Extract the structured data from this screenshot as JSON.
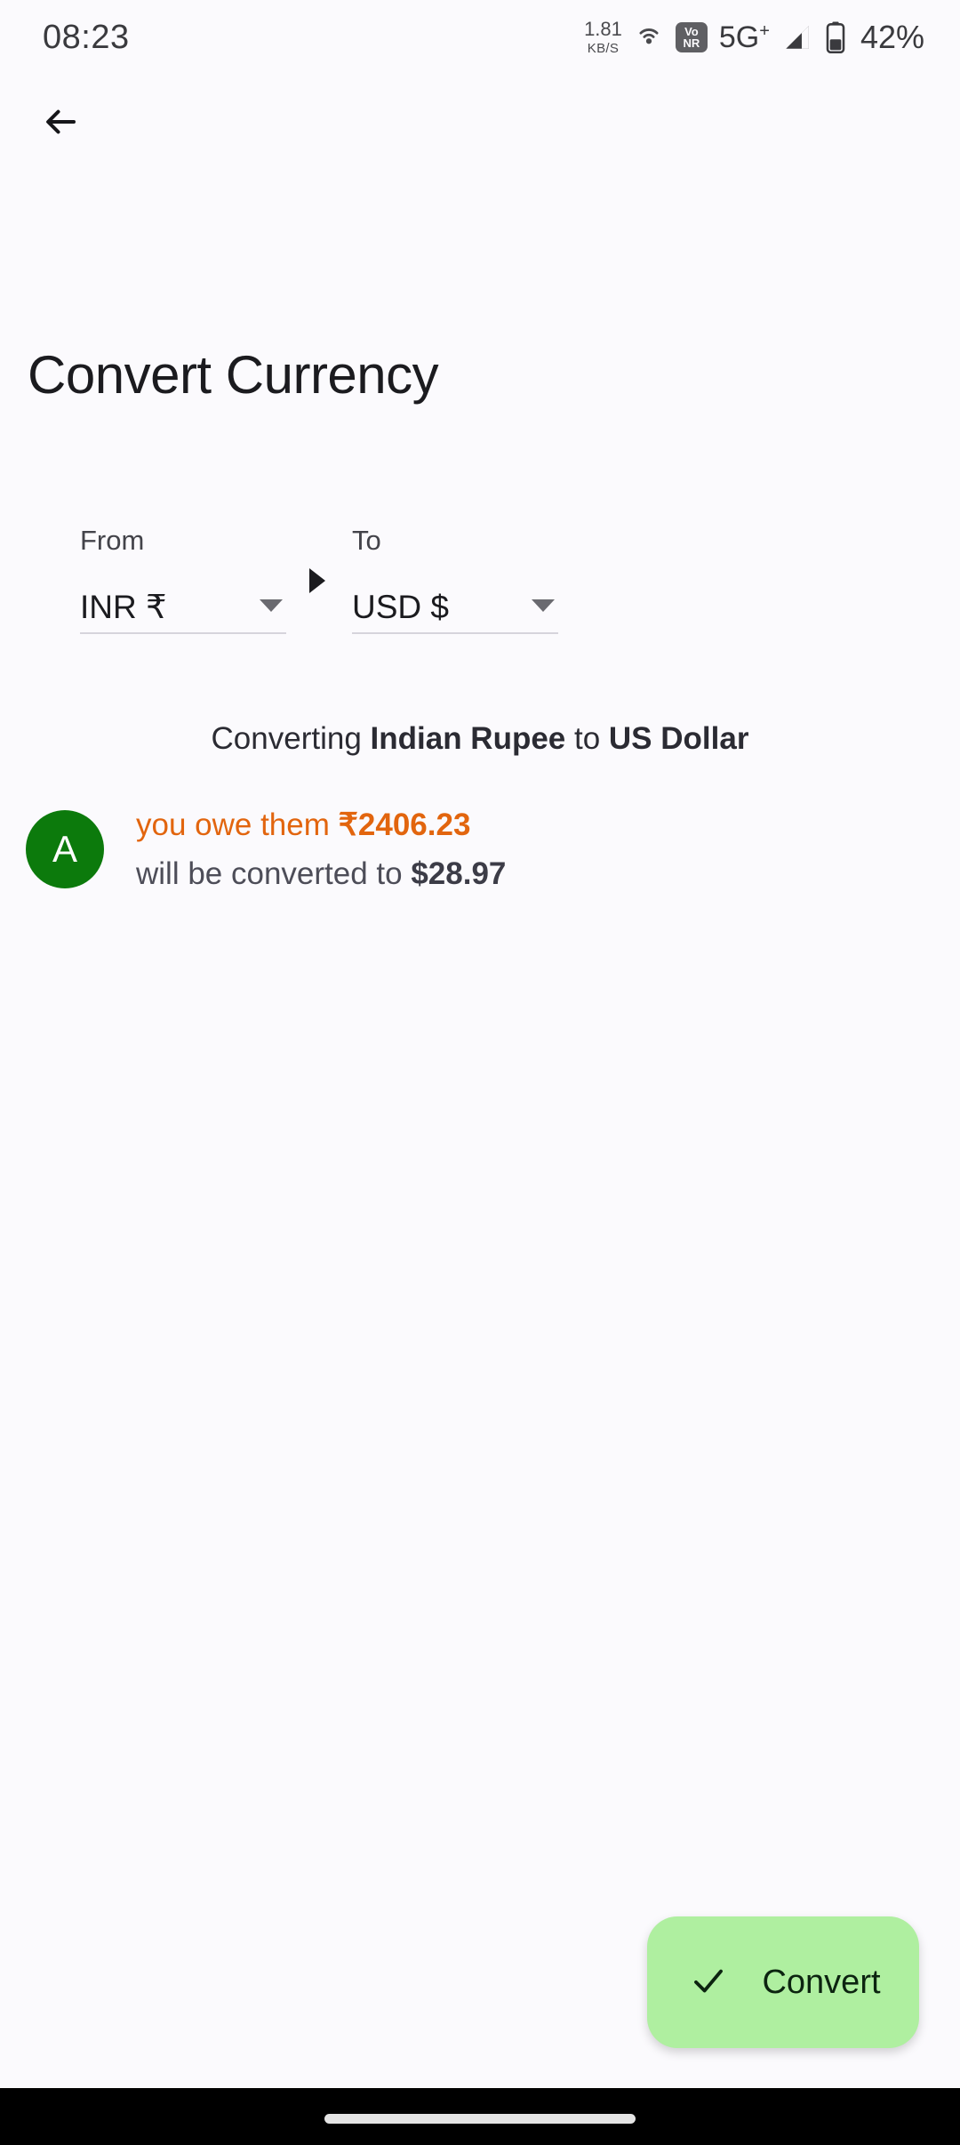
{
  "status_bar": {
    "time": "08:23",
    "net_speed_value": "1.81",
    "net_speed_unit": "KB/S",
    "hotspot_icon": "hotspot-icon",
    "vonr_line1": "Vo",
    "vonr_line2": "NR",
    "network_generation": "5G",
    "network_generation_sup": "+",
    "signal_icon": "signal-bars-icon",
    "battery_icon": "battery-icon",
    "battery_percent": "42%"
  },
  "app_bar": {
    "back_icon": "back-arrow-icon"
  },
  "page": {
    "title": "Convert Currency"
  },
  "converter": {
    "from": {
      "label": "From",
      "value": "INR ₹",
      "caret_icon": "chevron-down-icon"
    },
    "direction_icon": "arrow-right-icon",
    "to": {
      "label": "To",
      "value": "USD $",
      "caret_icon": "chevron-down-icon"
    }
  },
  "converting_note": {
    "prefix": "Converting ",
    "from_currency_name": "Indian Rupee",
    "joiner": " to ",
    "to_currency_name": "US Dollar"
  },
  "amount_card": {
    "avatar_initial": "A",
    "avatar_color": "#0C7A0C",
    "owe_prefix": "you owe them ",
    "owe_amount": "₹2406.23",
    "owe_color": "#E2650E",
    "converted_prefix": "will be converted to ",
    "converted_amount": "$28.97"
  },
  "fab": {
    "check_icon": "check-icon",
    "label": "Convert",
    "color": "#AFEFA0"
  },
  "nav_bar": {
    "gesture_pill": "home-gesture-pill"
  }
}
